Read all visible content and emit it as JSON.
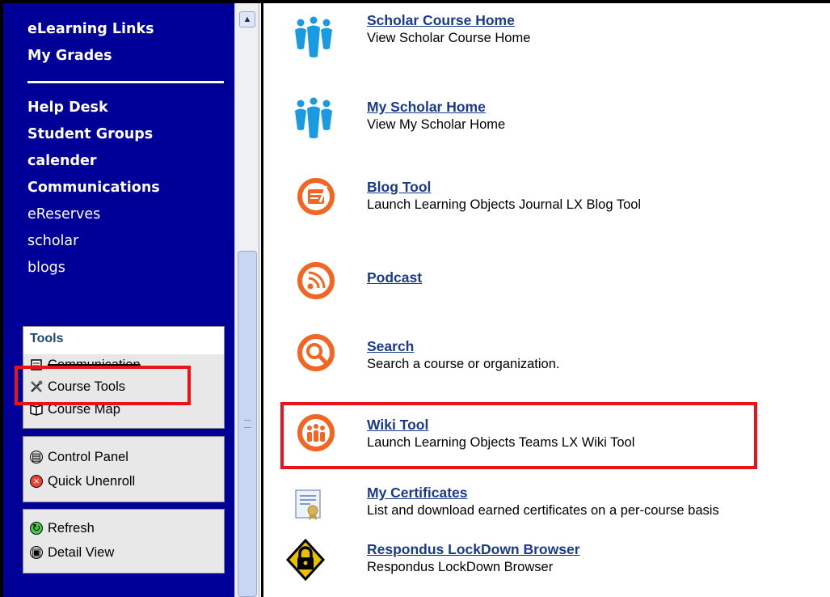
{
  "sidebar": {
    "links": [
      {
        "label": "eLearning Links",
        "bold": true
      },
      {
        "label": "My Grades",
        "bold": true
      },
      {
        "label": "Help Desk",
        "bold": true
      },
      {
        "label": "Student Groups",
        "bold": true
      },
      {
        "label": "calender",
        "bold": true
      },
      {
        "label": "Communications",
        "bold": true
      },
      {
        "label": "eReserves",
        "bold": false
      },
      {
        "label": "scholar",
        "bold": false
      },
      {
        "label": "blogs",
        "bold": false
      }
    ],
    "tools_panel": {
      "header": "Tools",
      "items": [
        {
          "label": "Communication",
          "icon": "communication-icon"
        },
        {
          "label": "Course Tools",
          "icon": "tools-icon"
        },
        {
          "label": "Course Map",
          "icon": "map-book-icon"
        }
      ]
    },
    "control_panel": {
      "items": [
        {
          "label": "Control Panel",
          "icon": "control-panel-icon"
        },
        {
          "label": "Quick Unenroll",
          "icon": "unenroll-icon"
        }
      ]
    },
    "view_panel": {
      "items": [
        {
          "label": "Refresh",
          "icon": "refresh-icon"
        },
        {
          "label": "Detail View",
          "icon": "detail-view-icon"
        }
      ]
    }
  },
  "tools_list": [
    {
      "title": "Scholar Course Home",
      "description": "View Scholar Course Home",
      "icon": "scholar-people-icon",
      "color": "#1a9ae0"
    },
    {
      "title": "My Scholar Home",
      "description": "View My Scholar Home",
      "icon": "scholar-people-icon",
      "color": "#1a9ae0"
    },
    {
      "title": "Blog Tool",
      "description": "Launch Learning Objects Journal LX Blog Tool",
      "icon": "blog-icon",
      "color": "#f26522"
    },
    {
      "title": "Podcast",
      "description": "",
      "icon": "podcast-icon",
      "color": "#f26522"
    },
    {
      "title": "Search",
      "description": "Search a course or organization.",
      "icon": "search-icon",
      "color": "#f26522"
    },
    {
      "title": "Wiki Tool",
      "description": "Launch Learning Objects Teams LX Wiki Tool",
      "icon": "wiki-team-icon",
      "color": "#f26522"
    },
    {
      "title": "My Certificates",
      "description": "List and download earned certificates on a per-course basis",
      "icon": "certificate-icon",
      "color": "#c8a24a"
    },
    {
      "title": "Respondus LockDown Browser",
      "description": "Respondus LockDown Browser",
      "icon": "lockdown-lock-icon",
      "color": "#e8c000"
    }
  ],
  "highlight_color": "#e8141a"
}
